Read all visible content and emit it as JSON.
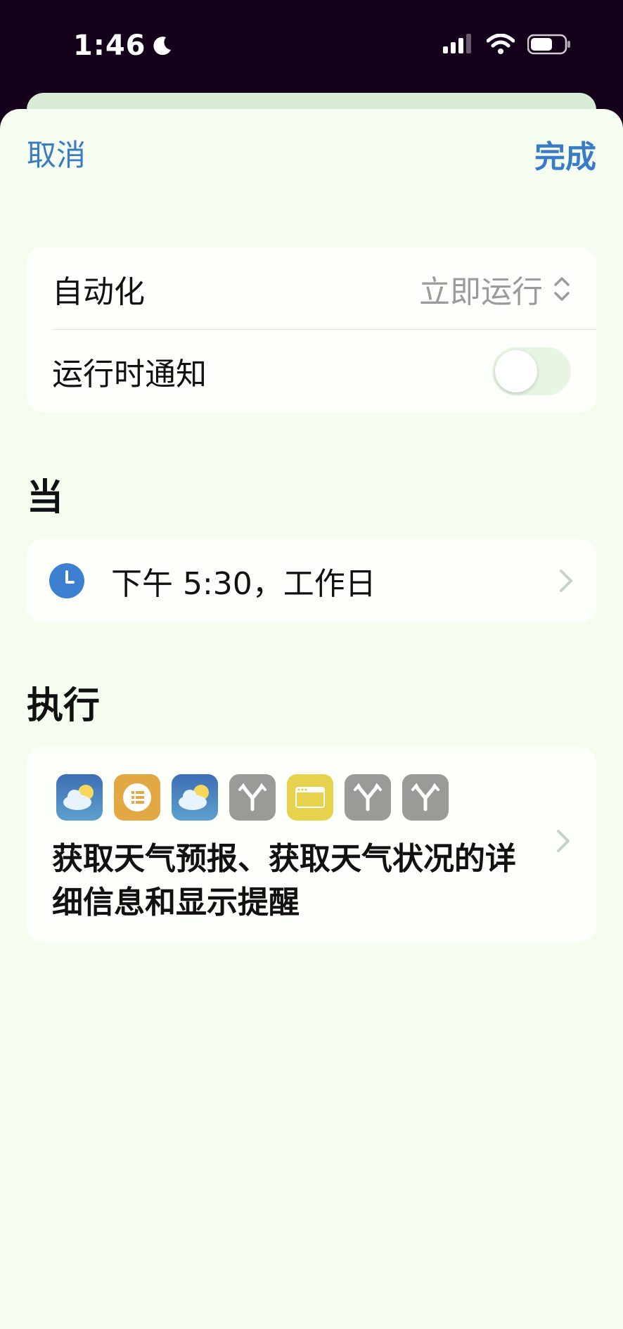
{
  "status_bar": {
    "time": "1:46"
  },
  "nav": {
    "cancel_label": "取消",
    "done_label": "完成"
  },
  "settings": {
    "automation_label": "自动化",
    "automation_value": "立即运行",
    "notify_label": "运行时通知",
    "notify_enabled": false
  },
  "when": {
    "title": "当",
    "trigger_text": "下午 5:30，工作日"
  },
  "do": {
    "title": "执行",
    "action_icons": [
      "weather-icon",
      "list-icon",
      "weather-icon",
      "branch-icon",
      "window-icon",
      "branch-icon",
      "branch-icon"
    ],
    "description": "获取天气预报、获取天气状况的详细信息和显示提醒"
  },
  "colors": {
    "accent": "#3a7bc8",
    "sheet_background": "#f5fcf0",
    "status_background": "#14001a"
  }
}
